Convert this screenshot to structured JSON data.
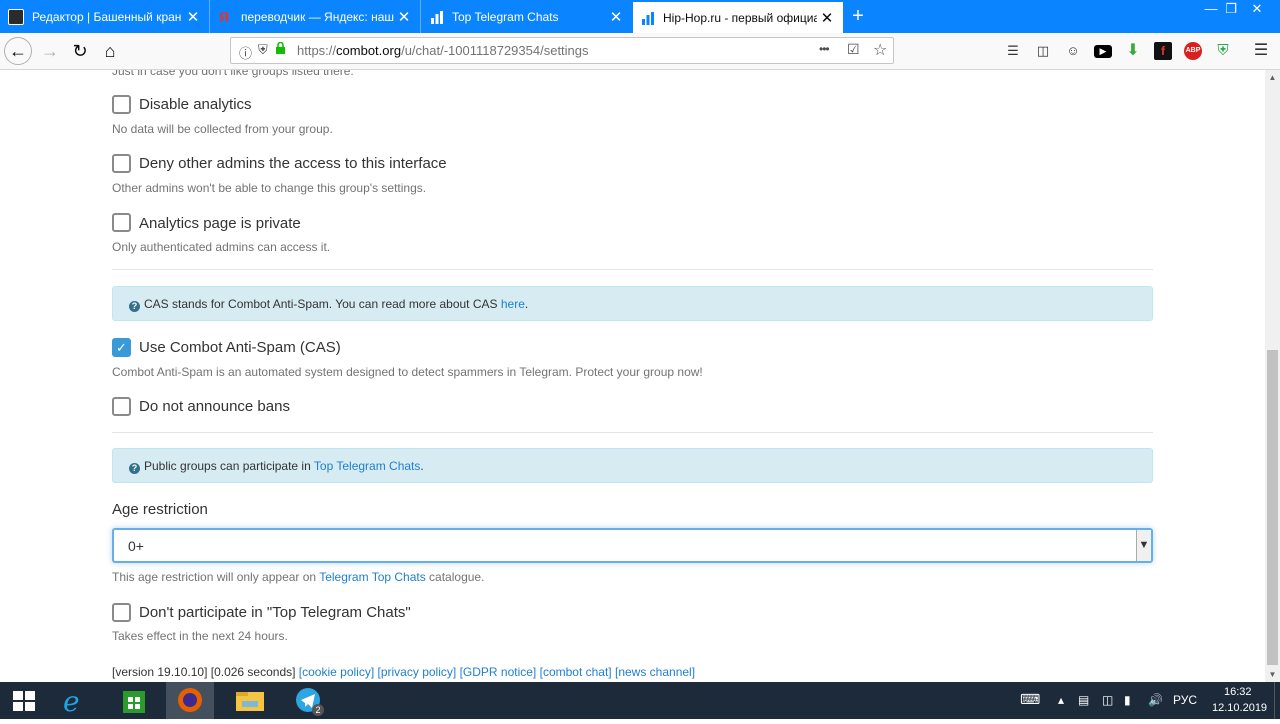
{
  "browser": {
    "tabs": [
      {
        "title": "Редактор | Башенный кран | Я",
        "favicon_color": "#2b2b2b",
        "close": "✕"
      },
      {
        "title": "переводчик — Яндекс: нашло",
        "favicon_color": "#e6332a",
        "close": "✕"
      },
      {
        "title": "Top Telegram Chats",
        "favicon_color": "#ffffff",
        "close": "✕"
      },
      {
        "title": "Hip-Hop.ru - первый официа",
        "favicon_color": "#0a84ff",
        "close": "✕"
      }
    ],
    "new_tab": "+",
    "url_prefix": "https://",
    "url_domain": "combot.org",
    "url_path": "/u/chat/-1001118729354/settings",
    "url_more": "•••"
  },
  "settings": {
    "clipped_hint": "Just in case you don't like groups listed there.",
    "disable_analytics": {
      "label": "Disable analytics",
      "hint": "No data will be collected from your group.",
      "checked": false
    },
    "deny_admins": {
      "label": "Deny other admins the access to this interface",
      "hint": "Other admins won't be able to change this group's settings.",
      "checked": false
    },
    "analytics_private": {
      "label": "Analytics page is private",
      "hint": "Only authenticated admins can access it.",
      "checked": false
    },
    "cas_info": {
      "text": "CAS stands for Combot Anti-Spam. You can read more about CAS ",
      "link": "here",
      "end": "."
    },
    "use_cas": {
      "label": "Use Combot Anti-Spam (CAS)",
      "hint": "Combot Anti-Spam is an automated system designed to detect spammers in Telegram. Protect your group now!",
      "checked": true
    },
    "no_announce": {
      "label": "Do not announce bans",
      "checked": false
    },
    "top_info": {
      "text": "Public groups can participate in ",
      "link": "Top Telegram Chats",
      "end": "."
    },
    "age": {
      "label": "Age restriction",
      "value": "0+",
      "hint_pre": "This age restriction will only appear on ",
      "hint_link": "Telegram Top Chats",
      "hint_post": " catalogue."
    },
    "no_participate": {
      "label": "Don't participate in \"Top Telegram Chats\"",
      "hint": "Takes effect in the next 24 hours.",
      "checked": false
    }
  },
  "footer": {
    "version": "[version 19.10.10] [0.026 seconds] ",
    "links": [
      "[cookie policy]",
      "[privacy policy]",
      "[GDPR notice]",
      "[combot chat]",
      "[news channel]"
    ]
  },
  "taskbar": {
    "telegram_badge": "2",
    "lang": "РУС",
    "time": "16:32",
    "date": "12.10.2019"
  }
}
